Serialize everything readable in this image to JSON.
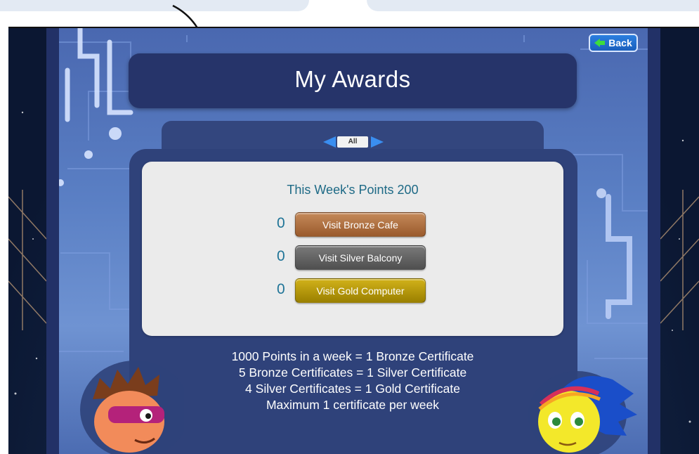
{
  "header": {
    "title": "My Awards"
  },
  "toolbar": {
    "back_label": "Back"
  },
  "filter": {
    "label": "All"
  },
  "points": {
    "this_week": "This Week's Points 200"
  },
  "awards": [
    {
      "count": "0",
      "label": "Visit Bronze Cafe",
      "color": "#a8663a"
    },
    {
      "count": "0",
      "label": "Visit Silver Balcony",
      "color": "#5c5c5c"
    },
    {
      "count": "0",
      "label": "Visit Gold Computer",
      "color": "#b39a0a"
    }
  ],
  "rules": [
    "1000 Points in a week = 1 Bronze Certificate",
    "5 Bronze Certificates = 1 Silver Certificate",
    "4 Silver Certificates = 1 Gold Certificate",
    "Maximum 1 certificate per week"
  ],
  "colors": {
    "accent": "#26346a",
    "button_blue": "#1a5fbd",
    "points_text": "#1e6a86"
  },
  "icons": {
    "back": "back-arrow-icon",
    "nav_prev": "chevron-left-icon",
    "nav_next": "chevron-right-icon"
  }
}
